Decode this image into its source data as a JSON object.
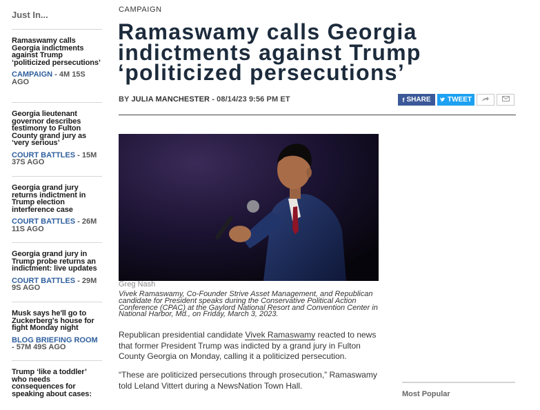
{
  "rail": {
    "title": "Just In...",
    "items": [
      {
        "headline": "Ramaswamy calls Georgia indictments against Trump ‘politicized persecutions’",
        "category": "CAMPAIGN",
        "age": " - 4M 15S AGO"
      },
      {
        "headline": "Georgia lieutenant governor describes testimony to Fulton County grand jury as ‘very serious’",
        "category": "COURT BATTLES",
        "age": " - 15M 37S AGO"
      },
      {
        "headline": "Georgia grand jury returns indictment in Trump election interference case",
        "category": "COURT BATTLES",
        "age": " - 26M 11S AGO"
      },
      {
        "headline": "Georgia grand jury in Trump probe returns an indictment: live updates",
        "category": "COURT BATTLES",
        "age": " - 29M 9S AGO"
      },
      {
        "headline": "Musk says he'll go to Zuckerberg's house for fight Monday night",
        "category": "BLOG BRIEFING ROOM",
        "age": " - 57M 49S AGO"
      },
      {
        "headline": "Trump ‘like a toddler’ who needs consequences for speaking about cases:",
        "category": "",
        "age": ""
      }
    ]
  },
  "article": {
    "kicker": "CAMPAIGN",
    "headline": "Ramaswamy calls Georgia indictments against Trump ‘politicized persecutions’",
    "byline_prefix": "BY ",
    "author": "JULIA MANCHESTER",
    "date": " - 08/14/23 9:56 PM ET",
    "share": {
      "facebook_label": "SHARE",
      "twitter_label": "TWEET"
    },
    "photo_credit": "Greg Nash",
    "caption": "Vivek Ramaswamy, Co-Founder Strive Asset Management, and Republican candidate for President speaks during the Conservative Political Action Conference (CPAC) at the Gaylord National Resort and Convention Center in National Harbor, Md., on Friday, March 3, 2023.",
    "p1_before": "Republican presidential candidate ",
    "p1_link": "Vivek Ramaswamy",
    "p1_after": " reacted to news that former President Trump was indicted by a grand jury in Fulton County Georgia on Monday, calling it a politicized persecution.",
    "p2": "“These are politicized persecutions through prosecution,” Ramaswamy told Leland Vittert during a NewsNation Town Hall."
  },
  "sidebar": {
    "most_popular": "Most Popular"
  },
  "icons": {
    "facebook": "f-icon",
    "twitter": "bird-icon",
    "share": "share-arrow-icon",
    "email": "envelope-icon"
  }
}
